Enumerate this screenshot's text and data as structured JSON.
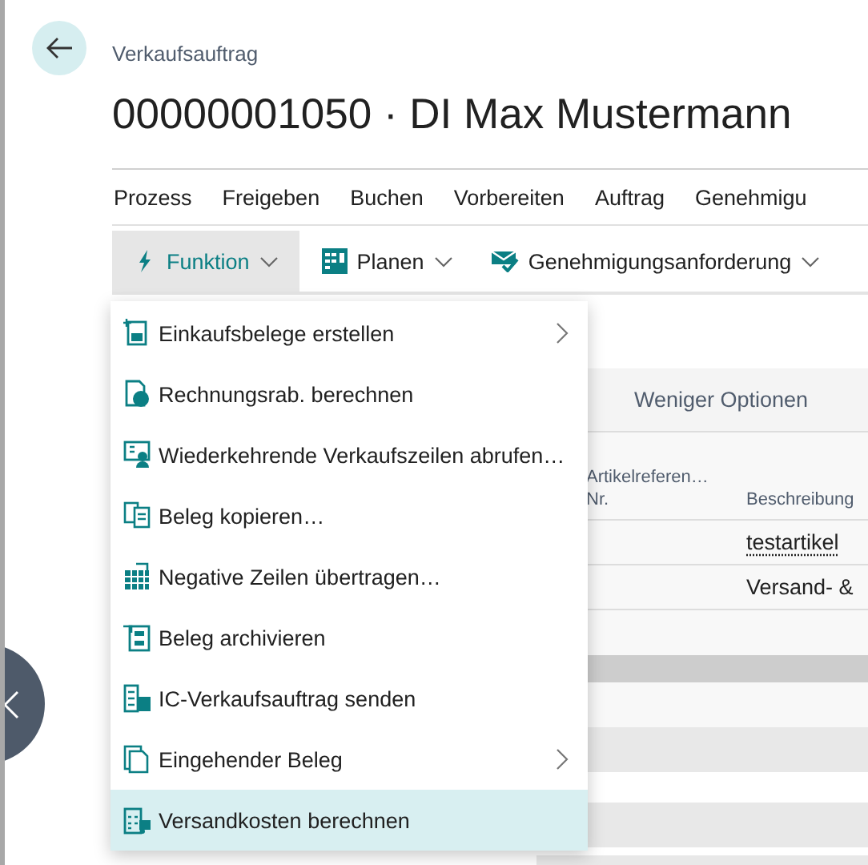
{
  "breadcrumb": "Verkaufsauftrag",
  "title": "00000001050 · DI Max Mustermann",
  "action_tabs": [
    {
      "label": "Prozess"
    },
    {
      "label": "Freigeben"
    },
    {
      "label": "Buchen"
    },
    {
      "label": "Vorbereiten"
    },
    {
      "label": "Auftrag"
    },
    {
      "label": "Genehmigu"
    }
  ],
  "toolbar": [
    {
      "label": "Funktion",
      "expanded": true
    },
    {
      "label": "Planen",
      "expanded": false
    },
    {
      "label": "Genehmigungsanforderung",
      "expanded": false
    }
  ],
  "menu": {
    "items": [
      {
        "label": "Einkaufsbelege erstellen",
        "submenu": true,
        "selected": false
      },
      {
        "label": "Rechnungsrab. berechnen",
        "submenu": false,
        "selected": false
      },
      {
        "label": "Wiederkehrende Verkaufszeilen abrufen…",
        "submenu": false,
        "selected": false
      },
      {
        "label": "Beleg kopieren…",
        "submenu": false,
        "selected": false
      },
      {
        "label": "Negative Zeilen übertragen…",
        "submenu": false,
        "selected": false
      },
      {
        "label": "Beleg archivieren",
        "submenu": false,
        "selected": false
      },
      {
        "label": "IC-Verkaufsauftrag senden",
        "submenu": false,
        "selected": false
      },
      {
        "label": "Eingehender Beleg",
        "submenu": true,
        "selected": false
      },
      {
        "label": "Versandkosten berechnen",
        "submenu": false,
        "selected": true
      }
    ]
  },
  "lines_panel": {
    "option": "Weniger Optionen",
    "columns": [
      {
        "lines": [
          "Artikelreferen…",
          "Nr."
        ]
      },
      {
        "lines": [
          "Beschreibung"
        ]
      }
    ],
    "rows": [
      {
        "description": "testartikel",
        "link": true
      },
      {
        "description": "Versand- &",
        "link": false
      }
    ]
  }
}
